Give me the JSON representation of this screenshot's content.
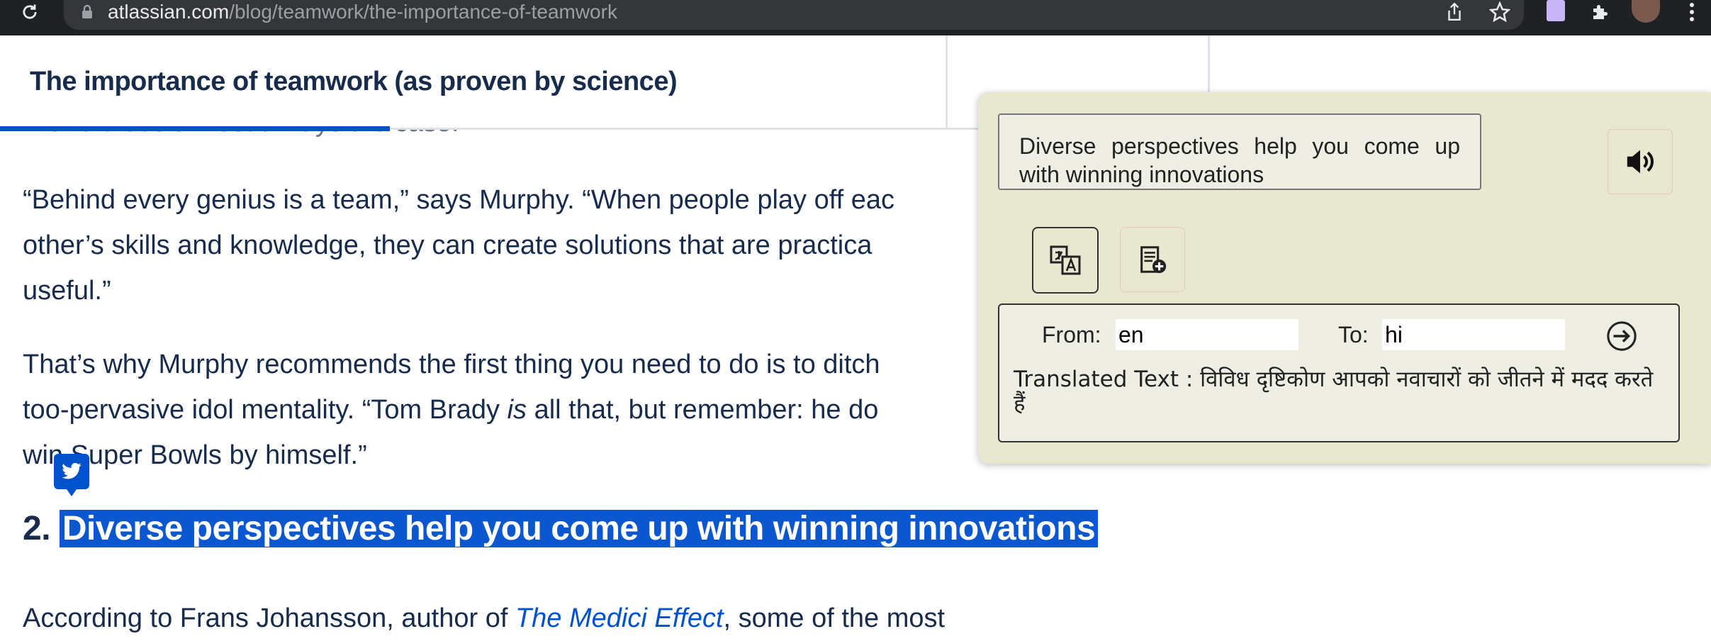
{
  "browser": {
    "url_host": "atlassian.com",
    "url_path": "/blog/teamwork/the-importance-of-teamwork"
  },
  "article": {
    "sticky_title": "The importance of teamwork (as proven by science)",
    "peek_line": "…and that's almost always the case.",
    "p1_line1": "“Behind every genius is a team,” says Murphy. “When people play off eac",
    "p1_line2": "other’s skills and knowledge, they can create solutions that are practica",
    "p1_line3": "useful.”",
    "p2_line1": "That’s why Murphy recommends the first thing you need to do is to ditch",
    "p2_line2_a": "too-pervasive idol mentality. “Tom Brady ",
    "p2_line2_em": "is",
    "p2_line2_b": " all that, but remember: he do",
    "p2_line3": "win Super Bowls by himself.”",
    "heading_num": "2.",
    "heading_text": "Diverse perspectives help you come up with winning innovations",
    "p3_a": "According to Frans Johansson, author of ",
    "p3_link": "The Medici Effect",
    "p3_b": ", some of the most"
  },
  "translator": {
    "source_text": "Diverse perspectives help you come up with winning innovations",
    "from_label": "From:",
    "from_value": "en",
    "to_label": "To:",
    "to_value": "hi",
    "translated_label": "Translated Text : ",
    "translated_value": "विविध दृष्टिकोण आपको नवाचारों को जीतने में मदद करते हैं"
  },
  "colors": {
    "accent": "#0052cc",
    "selection": "#0b57d0",
    "popup_bg": "#e8e7cf",
    "text": "#172b4d"
  },
  "icons": [
    "reload-icon",
    "lock-icon",
    "share-icon",
    "star-icon",
    "extension-icon",
    "puzzle-icon",
    "avatar",
    "more-icon",
    "twitter-icon",
    "speaker-icon",
    "translate-icon",
    "add-note-icon",
    "go-arrow-icon"
  ]
}
